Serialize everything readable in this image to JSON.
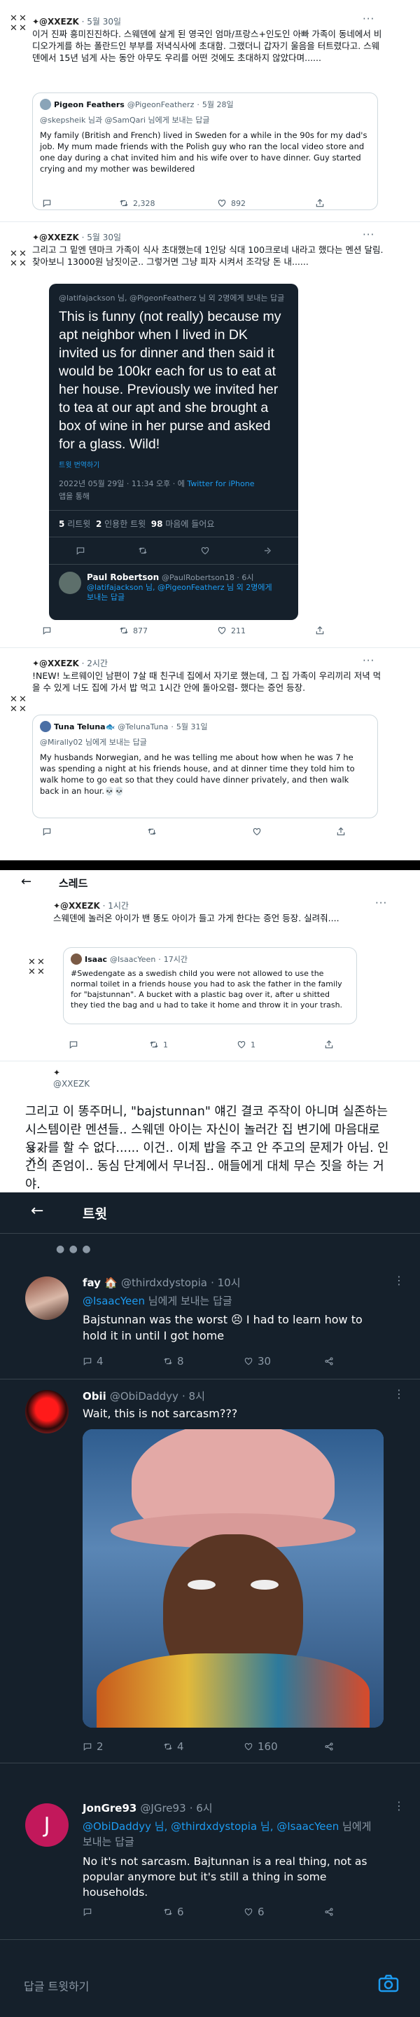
{
  "t1": {
    "name": "✦@XXEZK",
    "date": "5월 30일",
    "text": "이거 진짜 흥미진진하다. 스웨덴에 살게 된 영국인 엄마/프랑스+인도인 아빠 가족이 동네에서 비디오가게를 하는 폴란드인 부부를 저녁식사에 초대함. 그랬더니 갑자기 울음을 터트렸다고. 스웨덴에서 15년 넘게 사는 동안 아무도 우리를 어떤 것에도 초대하지 않았다며......",
    "quote": {
      "name": "Pigeon Feathers",
      "handle": "@PigeonFeatherz",
      "date": "5월 28일",
      "reply_to": "@skepsheik 님과 @SamQari 님에게 보내는 답글",
      "text": "My family (British and French) lived in Sweden for a while in the 90s for my dad's job. My mum made friends with the Polish guy who ran the local video store and one day during a chat invited him and his wife over to have dinner. Guy started crying and my mother was bewildered"
    },
    "retweets": "2,328",
    "likes": "892"
  },
  "t2": {
    "name": "✦@XXEZK",
    "date": "5월 30일",
    "text": "그리고 그 밑엔 덴마크 가족이 식사 초대했는데 1인당 식대 100크로네 내라고 했다는 멘션 달림. 찾아보니 13000원 남짓이군.. 그렇거면 그냥 피자 시켜서 조각당 돈 내......",
    "dark": {
      "reply_to": "@latifajackson 님, @PigeonFeatherz 님 외 2명에게 보내는 답글",
      "text": "This is funny (not really) because my apt neighbor when I lived in DK invited us for dinner and then said it would be 100kr each for us to eat at her house. Previously we invited her to tea at our apt and she brought a box of wine in her purse and asked for a glass. Wild!",
      "translate": "트윗 번역하기",
      "meta_time": "2022년 05월 29일 · 11:34 오후 · 에 ",
      "meta_app": "Twitter for iPhone",
      "meta_more": "앱을 통해",
      "stat_rt_num": "5",
      "stat_rt_label": "리트윗",
      "stat_qt_num": "2",
      "stat_qt_label": "인용한 트윗",
      "stat_like_num": "98",
      "stat_like_label": "마음에 들어요",
      "reply_name": "Paul Robertson",
      "reply_handle": "@PaulRobertson18 · 6시"
    },
    "retweets": "877",
    "likes": "211"
  },
  "t3": {
    "name": "✦@XXEZK",
    "date": "2시간",
    "text": "!NEW! 노르웨이인 남편이 7살 때 친구네 집에서 자기로 했는데, 그 집 가족이 우리끼리 저녁 먹을 수 있게 너도 집에 가서 밥 먹고 1시간 안에 돌아오렴- 했다는 증언 등장.",
    "quote": {
      "name": "Tuna Teluna🐟",
      "handle": "@TelunaTuna",
      "date": "5월 31일",
      "reply_to": "@Mirally02 님에게 보내는 답글",
      "text": "My husbands Norwegian, and he was telling me about how when he was 7 he was spending a night at his friends house, and at dinner time they told him to walk home to go eat so that they could have dinner privately, and then walk back in an hour.💀💀"
    }
  },
  "thread": {
    "title": "스레드",
    "t4": {
      "name": "✦@XXEZK",
      "date": "1시간",
      "text": "스웨덴에 놀러온 아이가 밴 똥도 아이가 들고 가게 한다는 증언 등장. 실려줘....",
      "quote": {
        "name": "Isaac",
        "handle": "@IsaacYeen",
        "date": "17시간",
        "text": "#Swedengate as a swedish child you were not allowed to use the normal toilet in a friends house you had to ask the father in the family for \"bajstunnan\". A bucket with a plastic bag over it, after u shitted they tied the bag and u had to take it home and throw it in your trash."
      },
      "retweets": "1",
      "likes": "1"
    },
    "t5": {
      "name": "✦",
      "handle": "@XXEZK",
      "text": "그리고 이 똥주머니, \"bajstunnan\" 얘긴 결코 주작이 아니며 실존하는 시스템이란 멘션들.. 스웨덴 아이는 자신이 놀러간 집 변기에 마음대로 용가를 할 수 없다...... 이건.. 이제 밥을 주고 안 주고의 문제가 아님. 인간의 존엄이.. 동심 단계에서 무너짐.. 애들에게 대체 무슨 짓을 하는 거야."
    }
  },
  "dark_screen": {
    "title": "트윗",
    "r1": {
      "name": "fay 🏠",
      "handle": "@thirdxdystopia",
      "time": "· 10시",
      "reply_to_user": "@IsaacYeen",
      "reply_to_rest": " 님에게 보내는 답글",
      "text": "Bajstunnan was the worst 😣 I had to learn how to hold it in until I got home",
      "replies": "4",
      "retweets": "8",
      "likes": "30"
    },
    "r2": {
      "name": "Obii",
      "handle": "@ObiDaddyy",
      "time": "· 8시",
      "text": "Wait, this is not sarcasm???",
      "replies": "2",
      "retweets": "4",
      "likes": "160"
    },
    "r3": {
      "name": "JonGre93",
      "handle": "@JGre93",
      "time": "· 6시",
      "avatar_letter": "J",
      "reply_users": "@ObiDaddyy 님, @thirdxdystopia 님, @IsaacYeen",
      "reply_rest": " 님에게 보내는 답글",
      "text": "No it's not sarcasm. Bajtunnan is a real thing, not as popular anymore but it's still a thing in some households.",
      "retweets": "6",
      "likes": "6"
    },
    "compose_placeholder": "답글 트윗하기"
  },
  "colors": {
    "accent": "#1d9bf0",
    "dark_bg": "#15202b",
    "avatar_red": "#c2185b"
  }
}
